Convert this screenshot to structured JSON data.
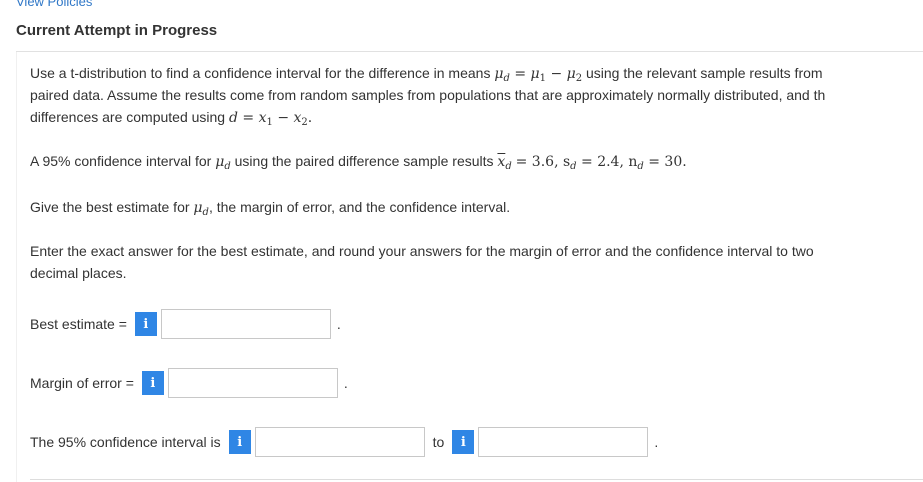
{
  "header": {
    "link": "View Policies",
    "title": "Current Attempt in Progress"
  },
  "question": {
    "intro1_a": "Use a t-distribution to find a confidence interval for the difference in means",
    "intro1_b": "using the relevant sample results from",
    "intro2": "paired data. Assume the results come from random samples from populations that are approximately normally distributed, and th",
    "intro3": "differences are computed using",
    "ci_text_a": "A 95% confidence interval for",
    "ci_text_b": "using the paired difference sample results",
    "stats": "= 3.6, s",
    "stats2": "= 2.4, n",
    "stats3": "= 30.",
    "give_a": "Give the best estimate for",
    "give_b": ", the margin of error, and the confidence interval.",
    "instructions1": "Enter the exact answer for the best estimate, and round your answers for the margin of error and the confidence interval to two",
    "instructions2": "decimal places."
  },
  "answers": {
    "best_estimate_label": "Best estimate =",
    "best_estimate_value": "",
    "margin_label": "Margin of error =",
    "margin_value": "",
    "interval_label": "The 95% confidence interval is",
    "interval_lower": "",
    "to_label": "to",
    "interval_upper": "",
    "info_glyph": "i",
    "period": "."
  },
  "colors": {
    "link": "#2f77c7",
    "info_button": "#2f86e5"
  }
}
